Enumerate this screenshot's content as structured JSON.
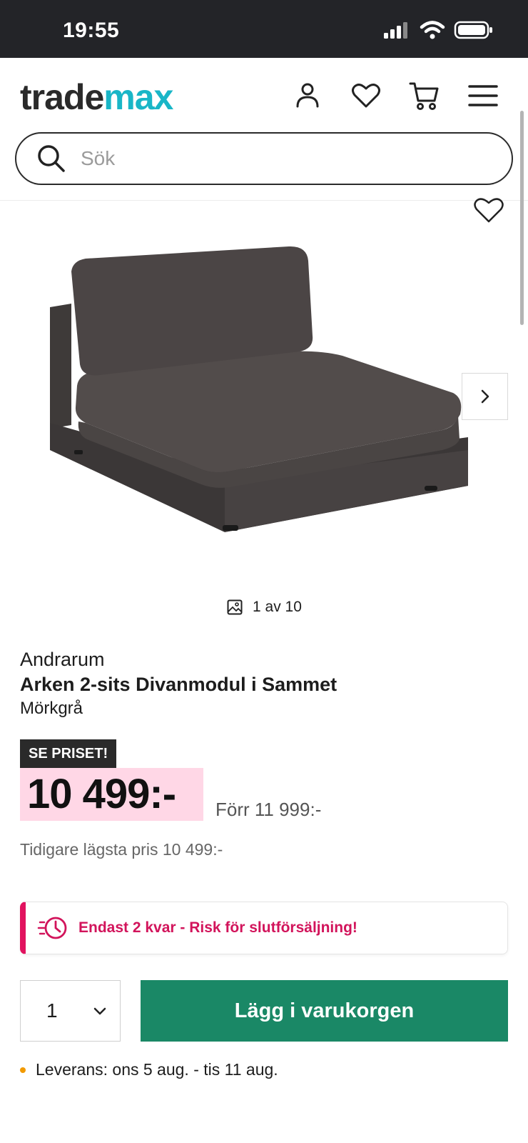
{
  "status_bar": {
    "time": "19:55"
  },
  "header": {
    "logo_part1": "trade",
    "logo_part2": "max",
    "search_placeholder": "Sök"
  },
  "gallery": {
    "counter": "1 av 10"
  },
  "product": {
    "brand": "Andrarum",
    "title": "Arken 2-sits Divanmodul i Sammet",
    "variant": "Mörkgrå",
    "badge": "SE PRISET!",
    "price": "10 499:-",
    "before_price": "Förr 11 999:-",
    "lowest_price": "Tidigare lägsta pris 10 499:-"
  },
  "stock_alert": "Endast 2 kvar - Risk för slutförsäljning!",
  "purchase": {
    "quantity": "1",
    "add_to_cart": "Lägg i varukorgen"
  },
  "delivery": "Leverans: ons 5 aug. - tis 11 aug.",
  "colors": {
    "accent_green": "#1a8866",
    "sale_pink": "#ffd7e6",
    "alert_pink": "#d2145b",
    "logo_teal": "#19b6c7"
  }
}
